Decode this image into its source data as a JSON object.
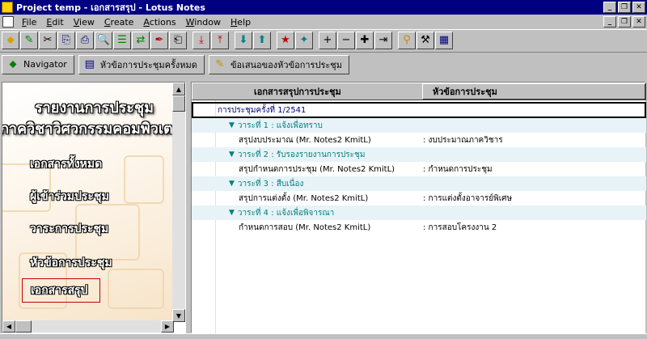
{
  "window": {
    "title": "Project temp - เอกสารสรุป - Lotus Notes"
  },
  "menu": {
    "items": [
      {
        "label": "File",
        "key": "F",
        "rest": "ile"
      },
      {
        "label": "Edit",
        "key": "E",
        "rest": "dit"
      },
      {
        "label": "View",
        "key": "V",
        "rest": "iew"
      },
      {
        "label": "Create",
        "key": "C",
        "rest": "reate"
      },
      {
        "label": "Actions",
        "key": "A",
        "rest": "ctions"
      },
      {
        "label": "Window",
        "key": "W",
        "rest": "indow"
      },
      {
        "label": "Help",
        "key": "H",
        "rest": "elp"
      }
    ]
  },
  "toolbar": {
    "icons": [
      "⬥",
      "✎",
      "✂",
      "⎘",
      "⎙",
      "🔍",
      "☰",
      "⇄",
      "✒",
      "⎗",
      "⤓",
      "⤒",
      "⬇",
      "⬆",
      "★",
      "✦",
      "+",
      "−",
      "✚",
      "⇥",
      "⚲",
      "⚒",
      "▦"
    ]
  },
  "actions": {
    "navigator": "Navigator",
    "all_topics": "หัวข้อการประชุมครั้งหมด",
    "propose_topic": "ข้อเสนอของหัวข้อการประชุม"
  },
  "nav": {
    "heading1": "รายงานการประชุม",
    "heading2": "ภาควิชาวิศวกรรมคอมพิวเตอร์",
    "links": [
      "เอกสารทั้งหมด",
      "ผู้เข้าร่วมประชุม",
      "วาระการประชุม",
      "หัวข้อการประชุม",
      "เอกสารสรุป"
    ]
  },
  "view": {
    "columns": [
      "เอกสารสรุปการประชุม",
      "หัวข้อการประชุม"
    ],
    "meeting": "การประชุมครั้งที่ 1/2541",
    "agendas": [
      {
        "label": "วาระที่ 1 : แจ้งเพื่อทราบ",
        "doc": "สรุปงบประมาณ  (Mr. Notes2 KmitL)",
        "topic": ": งบประมาณภาควิชาร"
      },
      {
        "label": "วาระที่ 2 : รับรองรายงานการประชุม",
        "doc": "สรุปกำหนดการประชุม  (Mr. Notes2 KmitL)",
        "topic": ": กำหนดการประชุม"
      },
      {
        "label": "วาระที่ 3 : สืบเนื่อง",
        "doc": "สรุปการแต่งตั้ง  (Mr. Notes2 KmitL)",
        "topic": ": การแต่งตั้งอาจารย์พิเศษ"
      },
      {
        "label": "วาระที่ 4 : แจ้งเพื่อพิจารณา",
        "doc": "กำหนดการสอบ  (Mr. Notes2 KmitL)",
        "topic": ": การสอบโครงงาน 2"
      }
    ]
  }
}
